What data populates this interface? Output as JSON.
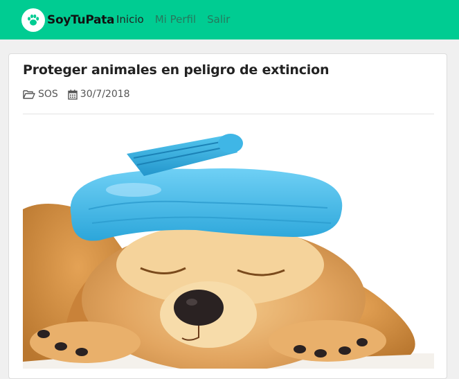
{
  "navbar": {
    "brand": "SoyTuPata",
    "brand_icon": "paw-icon",
    "links": [
      {
        "label": "Inicio"
      },
      {
        "label": "Mi Perfil"
      },
      {
        "label": "Salir"
      }
    ],
    "color": "#00cc92"
  },
  "post": {
    "title": "Proteger animales en peligro de extincion",
    "category": "SOS",
    "category_icon": "folder-open-icon",
    "date": "30/7/2018",
    "date_icon": "calendar-icon",
    "image_icon": "puppy-with-ice-bag-photo"
  }
}
